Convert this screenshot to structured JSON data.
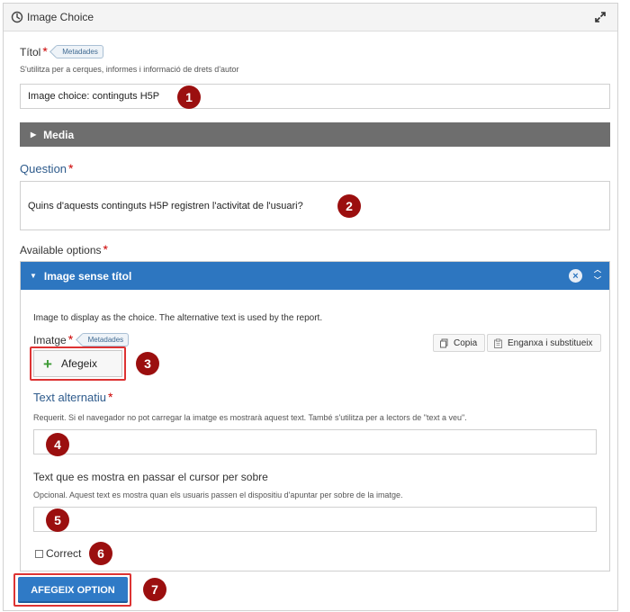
{
  "window": {
    "title": "Image Choice",
    "icon": "h5p-hub-icon",
    "expand_icon": "expand-icon"
  },
  "title_field": {
    "label": "Títol",
    "required_mark": "*",
    "metadata_tag": "Metadades",
    "description": "S'utilitza per a cerques, informes i informació de drets d'autor",
    "value": "Image choice: continguts H5P"
  },
  "media": {
    "label": "Media"
  },
  "question": {
    "label": "Question",
    "required_mark": "*",
    "value": "Quins d'aquests continguts H5P registren l'activitat de l'usuari?"
  },
  "available_options": {
    "label": "Available options",
    "required_mark": "*",
    "item": {
      "header": "Image sense títol",
      "description": "Image to display as the choice. The alternative text is used by the report.",
      "image_label": "Imatge",
      "image_required": "*",
      "image_metadata_tag": "Metadades",
      "copy_label": "Copia",
      "paste_label": "Enganxa i substitueix",
      "add_label": "Afegeix",
      "alt_text": {
        "label": "Text alternatiu",
        "required_mark": "*",
        "description": "Requerit. Si el navegador no pot carregar la imatge es mostrarà aquest text. També s'utilitza per a lectors de \"text a veu\".",
        "value": ""
      },
      "hover_text": {
        "label": "Text que es mostra en passar el cursor per sobre",
        "description": "Opcional. Aquest text es mostra quan els usuaris passen el dispositiu d'apuntar per sobre de la imatge.",
        "value": ""
      },
      "correct": {
        "label": "Correct",
        "checked": false
      }
    },
    "add_option_label": "AFEGEIX OPTION"
  },
  "markers": [
    "1",
    "2",
    "3",
    "4",
    "5",
    "6",
    "7"
  ],
  "colors": {
    "marker": "#9b0f0f",
    "accent_blue": "#2d76c0",
    "media_bar": "#6e6e6e",
    "highlight_outline": "#dd3333"
  }
}
